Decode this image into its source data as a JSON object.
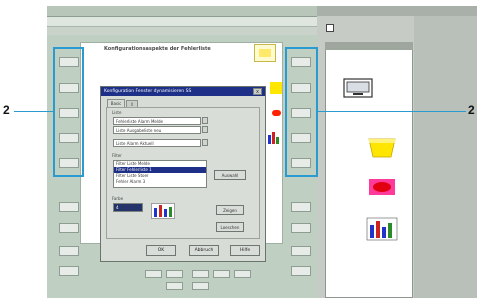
{
  "window": {
    "title": "",
    "canvas_title": "Konfigurationsaspekte der Fehlerliste"
  },
  "callouts": {
    "left_number": "2",
    "right_number": "2"
  },
  "dialog": {
    "title": "Konfiguration Fenster dynamisieren SS",
    "close_label": "x",
    "tabs": [
      "Basic",
      "X"
    ],
    "group1_label": "Liste",
    "field1": "Fehlerliste Alarm Melde",
    "field2": "Liste Ausgabeliste neu",
    "field3": "Liste Alarm Aktuell",
    "group2_label": "Filter",
    "list_items": [
      "Filter Liste Melde",
      "Filter Fehlerliste 1",
      "Filter Liste Stoer",
      "Fehler Alarm 3"
    ],
    "side_button_label": "Auswahl",
    "group3_label": "Farbe",
    "color_value": "4",
    "btn_a": "Zeigen",
    "btn_b": "Loeschen",
    "ok_label": "OK",
    "cancel_label": "Abbruch",
    "help_label": "Hilfe"
  },
  "colors": {
    "accent": "#2a9bd1",
    "dialog_title": "#1d2f86",
    "workspace_green": "#bfcfc2"
  },
  "icons": [
    "monitor-icon",
    "yellow-cylinder-icon",
    "red-oval-icon",
    "bar-chart-icon"
  ]
}
